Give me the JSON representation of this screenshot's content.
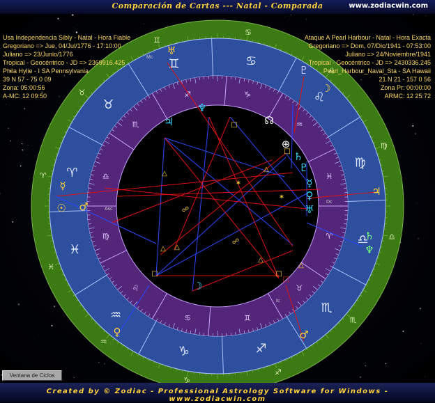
{
  "window": {
    "title": "Comparación de Cartas --- Natal - Comparada",
    "site": "www.zodiacwin.com"
  },
  "chart1": {
    "lines": [
      "Usa Independencia Sibly - Natal - Hora Fiable",
      "Gregoriano => Jue, 04/Jul/1776 - 17:10:00",
      "Juliano => 23/Junio/1776",
      "Tropical - Geocéntrico - JD => 2369916.425",
      "Phila Hylie - I SA Pennsylvania",
      "39 N 57 - 75 0 09",
      "Zona: 05:00:56",
      "A-MC: 12 09:50"
    ]
  },
  "chart2": {
    "lines": [
      "Ataque A Pearl Harbour - Natal - Hora Exacta",
      "Gregoriano => Dom, 07/Dic/1941 - 07:53:00",
      "Juliano => 24/Noviembre/1941",
      "Tropical - Geocéntrico - JD => 2430336.245",
      "Pearl_Harbour_Naval_Sta - SA Hawaii",
      "21 N 21 - 157 0 56",
      "Zona Pr: 00:00:00",
      "ARMC: 12 25:72"
    ]
  },
  "button": {
    "label": "Ventana de Ciclos"
  },
  "footer": {
    "text": "Created by © Zodiac - Professional Astrology Software for Windows - www.zodiacwin.com"
  },
  "colors": {
    "outer_ring": "#3c7a14",
    "zodiac_ring": "#2d4f9e",
    "house_ring": "#54267a",
    "lines_red": "#e01010",
    "lines_blue": "#2a48ff",
    "glyph_chart1": "#ffd23a",
    "glyph_chart2": "#3ad6ff"
  },
  "house_labels": [
    "Asc",
    "Mc",
    "Dc",
    "Ic"
  ],
  "outer_planets": [
    "☉",
    "☽",
    "☿",
    "♀",
    "♂",
    "♃",
    "♄",
    "♅",
    "♆",
    "♇"
  ],
  "inner_planets": [
    "♃",
    "♆",
    "♄",
    "♇",
    "☿",
    "♀",
    "☉",
    "♅",
    "♂",
    "☽",
    "♇"
  ],
  "signs": [
    "♈",
    "♉",
    "♊",
    "♋",
    "♌",
    "♍",
    "♎",
    "♏",
    "♐",
    "♑",
    "♒",
    "♓"
  ],
  "aspects": [
    "△",
    "□",
    "☍",
    "☌",
    "✶",
    "⚹"
  ]
}
